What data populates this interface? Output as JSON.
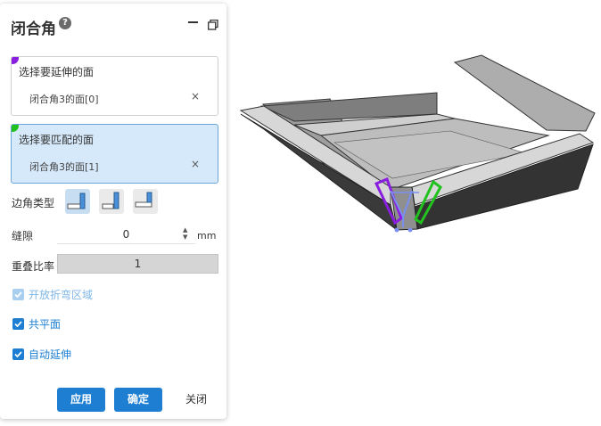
{
  "panel": {
    "title": "闭合角",
    "help_icon": "?",
    "select_extend": {
      "label": "选择要延伸的面",
      "item": "闭合角3的面[0]",
      "remove": "×",
      "accent": "#8a1ee0"
    },
    "select_match": {
      "label": "选择要匹配的面",
      "item": "闭合角3的面[1]",
      "remove": "×",
      "accent": "#22c21e"
    },
    "corner_type_label": "边角类型",
    "gap": {
      "label": "缝隙",
      "value": "0",
      "unit": "mm"
    },
    "overlap": {
      "label": "重叠比率",
      "value": "1"
    },
    "options": [
      {
        "label": "开放折弯区域",
        "checked": true,
        "disabled": true
      },
      {
        "label": "共平面",
        "checked": true,
        "disabled": false
      },
      {
        "label": "自动延伸",
        "checked": true,
        "disabled": false
      }
    ],
    "buttons": {
      "apply": "应用",
      "ok": "确定",
      "close": "关闭"
    }
  },
  "colors": {
    "primary": "#1e7fd2",
    "purple_highlight": "#8a1ee0",
    "green_highlight": "#22c21e",
    "edge_highlight": "#7a8ff0"
  }
}
